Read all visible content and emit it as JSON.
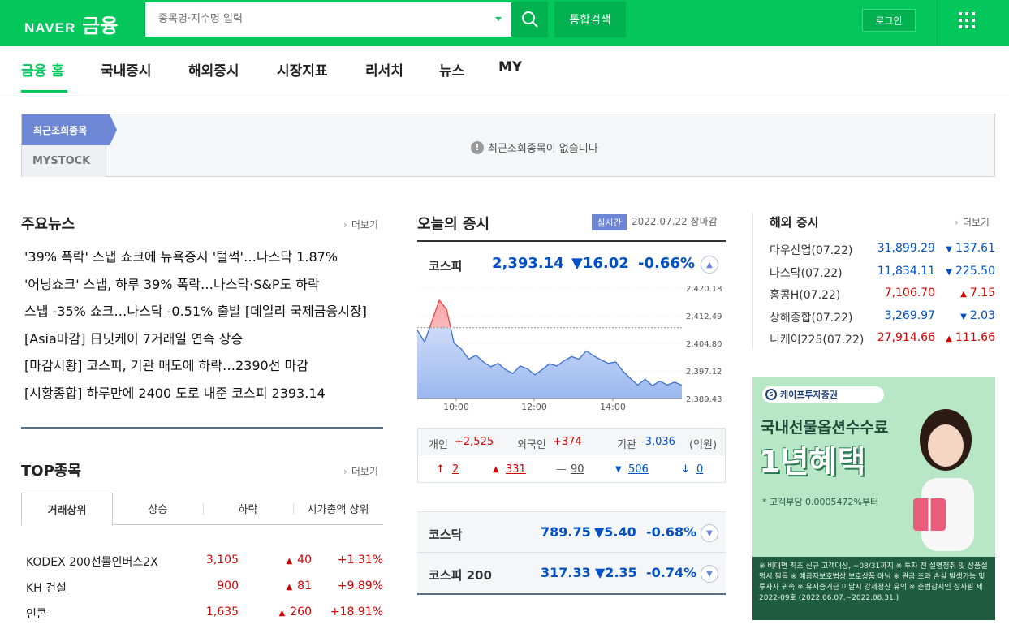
{
  "header": {
    "logo_naver": "NAVER",
    "logo_fin": "금융",
    "search_placeholder": "종목명·지수명 입력",
    "total_search": "통합검색",
    "login": "로그인"
  },
  "nav": {
    "items": [
      "금융 홈",
      "국내증시",
      "해외증시",
      "시장지표",
      "리서치",
      "뉴스",
      "MY"
    ]
  },
  "recent": {
    "tab_recent": "최근조회종목",
    "tab_mystock": "MYSTOCK",
    "empty_msg": "최근조회종목이 없습니다"
  },
  "main_news": {
    "title": "주요뉴스",
    "more": "더보기",
    "items": [
      "'39% 폭락' 스냅 쇼크에 뉴욕증시 '털썩'…나스닥 1.87%",
      "'어닝쇼크' 스냅, 하루 39% 폭락…나스닥·S&P도 하락",
      "스냅 -35% 쇼크…나스닥 -0.51% 출발 [데일리 국제금융시장]",
      "[Asia마감] 日닛케이 7거래일 연속 상승",
      "[마감시황] 코스피, 기관 매도에 하락…2390선 마감",
      "[시황종합] 하루만에 2400 도로 내준 코스피 2393.14"
    ]
  },
  "top_stocks": {
    "title": "TOP종목",
    "more": "더보기",
    "tabs": [
      "거래상위",
      "상승",
      "하락",
      "시가총액 상위"
    ],
    "rows": [
      {
        "name": "KODEX 200선물인버스2X",
        "price": "3,105",
        "change": "40",
        "pct": "+1.31%"
      },
      {
        "name": "KH 건설",
        "price": "900",
        "change": "81",
        "pct": "+9.89%"
      },
      {
        "name": "인콘",
        "price": "1,635",
        "change": "260",
        "pct": "+18.91%"
      }
    ]
  },
  "today": {
    "title": "오늘의 증시",
    "realtime": "실시간",
    "date": "2022.07.22",
    "status": "장마감",
    "kospi": {
      "name": "코스피",
      "value": "2,393.14",
      "change": "▼16.02",
      "pct": "-0.66%"
    },
    "investors": {
      "individual_label": "개인",
      "individual": "+2,525",
      "foreign_label": "외국인",
      "foreign": "+374",
      "inst_label": "기관",
      "inst": "-3,036",
      "unit": "(억원)"
    },
    "counts": {
      "upper": "2",
      "up": "331",
      "flat": "90",
      "down": "506",
      "lower": "0"
    },
    "kosdaq": {
      "name": "코스닥",
      "value": "789.75",
      "change": "▼5.40",
      "pct": "-0.68%"
    },
    "kospi200": {
      "name": "코스피 200",
      "value": "317.33",
      "change": "▼2.35",
      "pct": "-0.74%"
    }
  },
  "chart_data": {
    "type": "area",
    "x_ticks": [
      "10:00",
      "12:00",
      "14:00"
    ],
    "y_ticks": [
      "2,420.18",
      "2,412.49",
      "2,404.80",
      "2,397.12",
      "2,389.43"
    ],
    "ylim": [
      2389.43,
      2420.18
    ],
    "prev_close": 2409.16,
    "y": [
      2408.5,
      2405.2,
      2411.0,
      2416.8,
      2414.2,
      2404.9,
      2403.2,
      2400.4,
      2401.5,
      2399.6,
      2398.3,
      2399.2,
      2397.5,
      2396.4,
      2398.5,
      2397.7,
      2396.0,
      2397.5,
      2399.1,
      2398.5,
      2400.0,
      2401.1,
      2400.4,
      2402.7,
      2401.3,
      2400.2,
      2399.2,
      2399.6,
      2397.0,
      2395.0,
      2393.2,
      2394.8,
      2393.0,
      2394.3,
      2393.2,
      2394.0,
      2393.14
    ],
    "colors": {
      "above": "#e8454a",
      "below": "#3b6fd4"
    }
  },
  "world": {
    "title": "해외 증시",
    "more": "더보기",
    "rows": [
      {
        "name": "다우산업(07.22)",
        "value": "31,899.29",
        "change": "137.61",
        "dir": "down"
      },
      {
        "name": "나스닥(07.22)",
        "value": "11,834.11",
        "change": "225.50",
        "dir": "down"
      },
      {
        "name": "홍콩H(07.22)",
        "value": "7,106.70",
        "change": "7.15",
        "dir": "up"
      },
      {
        "name": "상해종합(07.22)",
        "value": "3,269.97",
        "change": "2.03",
        "dir": "down"
      },
      {
        "name": "니케이225(07.22)",
        "value": "27,914.66",
        "change": "111.66",
        "dir": "up"
      }
    ]
  },
  "ad": {
    "brand": "케이프투자증권",
    "line1": "국내선물옵션수수료",
    "line2": "1년혜택",
    "line3": "* 고객부담 0.0005472%부터",
    "disclaimer": "※ 비대면 최초 신규 고객대상, ~08/31까지 ※ 투자 전 설명청취 및 상품설명서 필독 ※ 예금자보호법상 보호상품 아님 ※ 원금 초과 손실 발생가능 및 투자자 귀속 ※ 유지증거금 미달시 강제청산 유의 ※ 준법감시인 심사필 제 2022-09호 (2022.06.07.~2022.08.31.)"
  }
}
